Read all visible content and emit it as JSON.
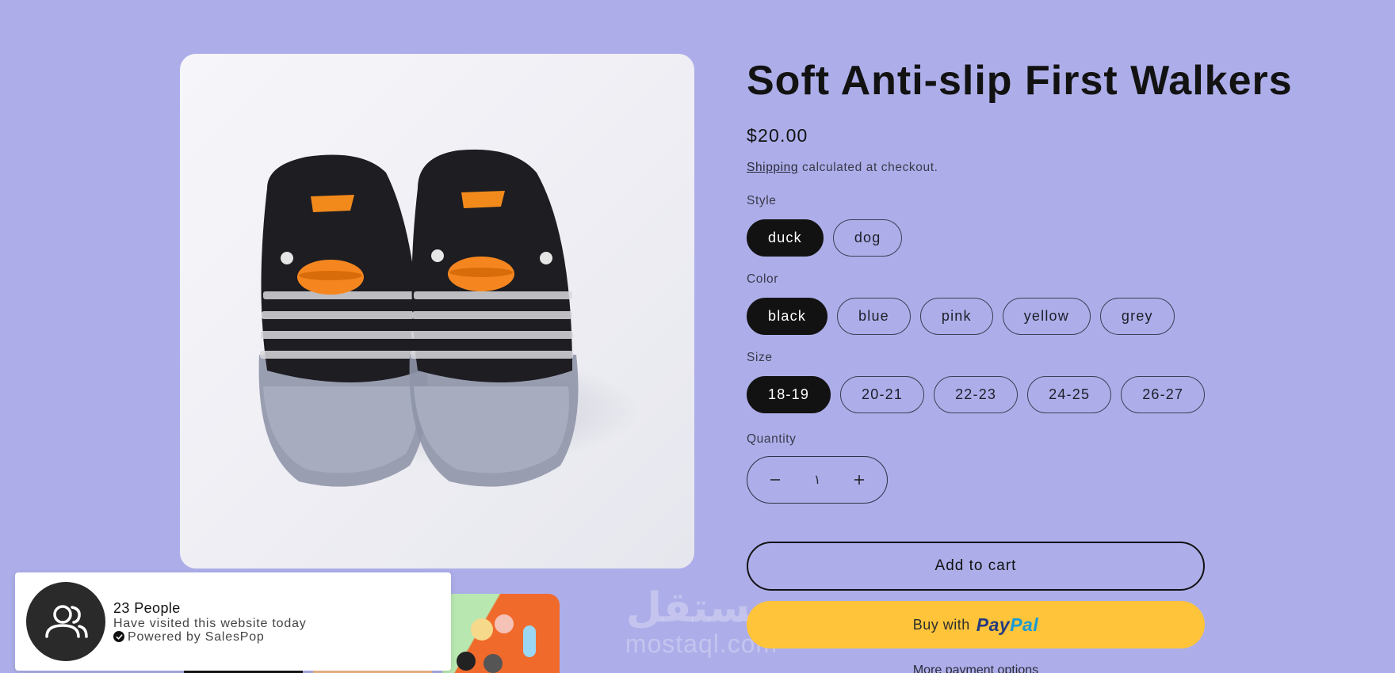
{
  "product": {
    "title": "Soft Anti-slip First Walkers",
    "price": "$20.00",
    "shipping_link": "Shipping",
    "shipping_suffix": " calculated at checkout."
  },
  "options": {
    "style": {
      "label": "Style",
      "values": [
        "duck",
        "dog"
      ],
      "selected": "duck"
    },
    "color": {
      "label": "Color",
      "values": [
        "black",
        "blue",
        "pink",
        "yellow",
        "grey"
      ],
      "selected": "black"
    },
    "size": {
      "label": "Size",
      "values": [
        "18-19",
        "20-21",
        "22-23",
        "24-25",
        "26-27"
      ],
      "selected": "18-19"
    }
  },
  "quantity": {
    "label": "Quantity",
    "value": "١",
    "decrease_icon": "minus-icon",
    "increase_icon": "plus-icon"
  },
  "buttons": {
    "add_to_cart": "Add to cart",
    "paypal_prefix": "Buy with",
    "paypal_pay": "Pay",
    "paypal_pal": "Pal",
    "more_options": "More payment options"
  },
  "popup": {
    "title": "23 People",
    "subtitle": "Have visited this website today",
    "powered": "Powered by SalesPop",
    "icon": "people-icon"
  },
  "watermark": {
    "arabic": "مستقل",
    "latin": "mostaql.com"
  },
  "colors": {
    "background": "#adaee9",
    "selected_pill": "#121212",
    "paypal_yellow": "#ffc43a",
    "paypal_dark_blue": "#253b80",
    "paypal_light_blue": "#179bd7"
  }
}
